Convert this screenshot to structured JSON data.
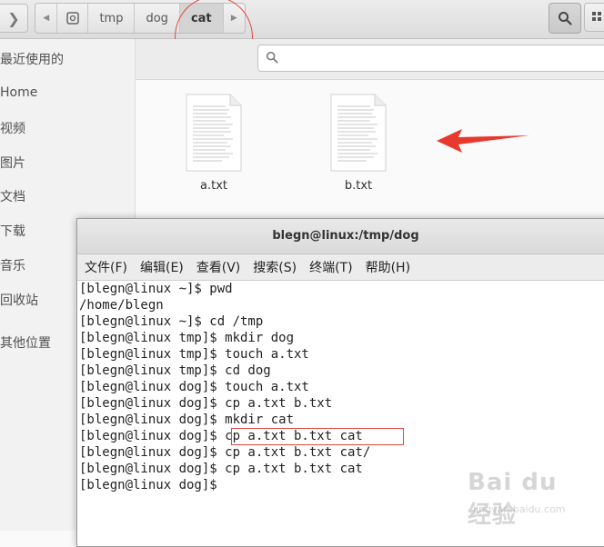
{
  "header": {
    "path": [
      "tmp",
      "dog",
      "cat"
    ],
    "active_path": "cat"
  },
  "sidebar": {
    "items": [
      {
        "label": "最近使用的"
      },
      {
        "label": "Home"
      },
      {
        "label": "视频"
      },
      {
        "label": "图片"
      },
      {
        "label": "文档"
      },
      {
        "label": "下载"
      },
      {
        "label": "音乐"
      },
      {
        "label": "回收站"
      },
      {
        "label": "其他位置"
      }
    ]
  },
  "search": {
    "value": "",
    "placeholder": ""
  },
  "files": [
    {
      "name": "a.txt"
    },
    {
      "name": "b.txt"
    }
  ],
  "terminal": {
    "title": "blegn@linux:/tmp/dog",
    "menu": [
      "文件(F)",
      "编辑(E)",
      "查看(V)",
      "搜索(S)",
      "终端(T)",
      "帮助(H)"
    ],
    "lines": [
      "[blegn@linux ~]$ pwd",
      "/home/blegn",
      "[blegn@linux ~]$ cd /tmp",
      "[blegn@linux tmp]$ mkdir dog",
      "[blegn@linux tmp]$ touch a.txt",
      "[blegn@linux tmp]$ cd dog",
      "[blegn@linux dog]$ touch a.txt",
      "[blegn@linux dog]$ cp a.txt b.txt",
      "[blegn@linux dog]$ mkdir cat",
      "[blegn@linux dog]$ cp a.txt b.txt cat",
      "[blegn@linux dog]$ cp a.txt b.txt cat/",
      "[blegn@linux dog]$ cp a.txt b.txt cat",
      "[blegn@linux dog]$ "
    ]
  },
  "watermark": {
    "logo": "Bai du 经验",
    "sub": "jingyan.baidu.com"
  },
  "colors": {
    "annotation_red": "#e04a3f",
    "sidebar_bg": "#f2f2f2",
    "header_bg": "#e2e2e2"
  },
  "icons": [
    "chevron-right-icon",
    "drive-icon",
    "search-icon",
    "view-grid-icon",
    "text-file-icon",
    "red-arrow-annotation"
  ]
}
